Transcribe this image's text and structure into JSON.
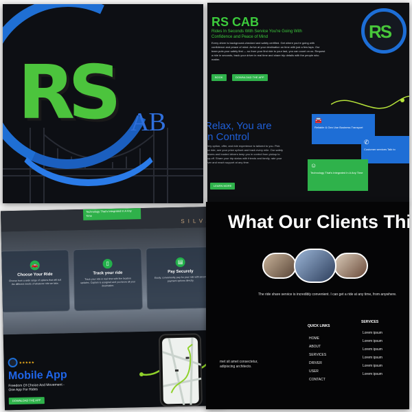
{
  "logo_panel": {
    "rs": "RS",
    "cab": "AB"
  },
  "hero_panel": {
    "title": "RS CAB",
    "subtitle": "Rides In Seconds With Service You're Going With Confidence and Peace of Mind",
    "paragraph": "Every driver is background-checked and safety certified. Get where you're going with confidence and peace of mind. Arrive at your destination on time with just a few taps. Our team puts your safety first — so from your first ride to your last, you can count on us. Request a ride in seconds, track your driver in real time and share trip details with the people who matter.",
    "btn_book": "BOOK",
    "btn_download": "DOWNLOAD THE APP",
    "relax_title_1": "Relax, You are",
    "relax_title_2": "In Control",
    "relax_paragraph": "Every option, offer, and ride experience is tailored to you. Pick your ride, see your price upfront and track every mile. Our safety features and trusted drivers keep you in control from pickup to drop-off. Share your trip status with friends and family, rate your driver and reach support at any time.",
    "relax_btn": "LEARN MORE",
    "card_blue_1": "Reliable & Gen Use Business Transport",
    "card_blue_2": "Customer services Talk to",
    "card_green": "Technology That's Integrated In A Any Time"
  },
  "app_panel": {
    "green_box": "Technology That's Integrated In A Any Time",
    "silva": "SILVA",
    "features": [
      {
        "title": "Choose Your Ride",
        "desc": "Choose from a wide range of options that will suit the different needs of whatever ride we take."
      },
      {
        "title": "Track your ride",
        "desc": "Track your ride in real time with live location updates. Captain is assigned and you know all your destination."
      },
      {
        "title": "Pay Securely",
        "desc": "Easily, conveniently, pay for your ride with secure payment options directly."
      }
    ],
    "stars": "★★★★★",
    "mobile_title": "Mobile App",
    "mobile_sub": "Freedom Of Choice And Movement - One App For Rides",
    "download_btn": "DOWNLOAD THE APP"
  },
  "clients_panel": {
    "title": "What Our Clients Thin",
    "quote": "The ride share service is incredibly convenient. I can get a ride at any time, from anywhere.",
    "address_1": "met sit amet consectetur,",
    "address_2": "adipiscing architecto.",
    "quick_links_title": "QUICK LINKS",
    "quick_links": [
      "HOME",
      "ABOUT",
      "SERVICES",
      "DRIVER",
      "USER",
      "CONTACT"
    ],
    "services_title": "SERVICES",
    "services": [
      "Lorem ipsum",
      "Lorem ipsum",
      "Lorem ipsum",
      "Lorem ipsum",
      "Lorem ipsum",
      "Lorem ipsum"
    ]
  },
  "colors": {
    "brand_green": "#3ccb3c",
    "brand_blue": "#1f65e8",
    "button_green": "#2fb24b",
    "card_blue": "#1e6ed6"
  }
}
